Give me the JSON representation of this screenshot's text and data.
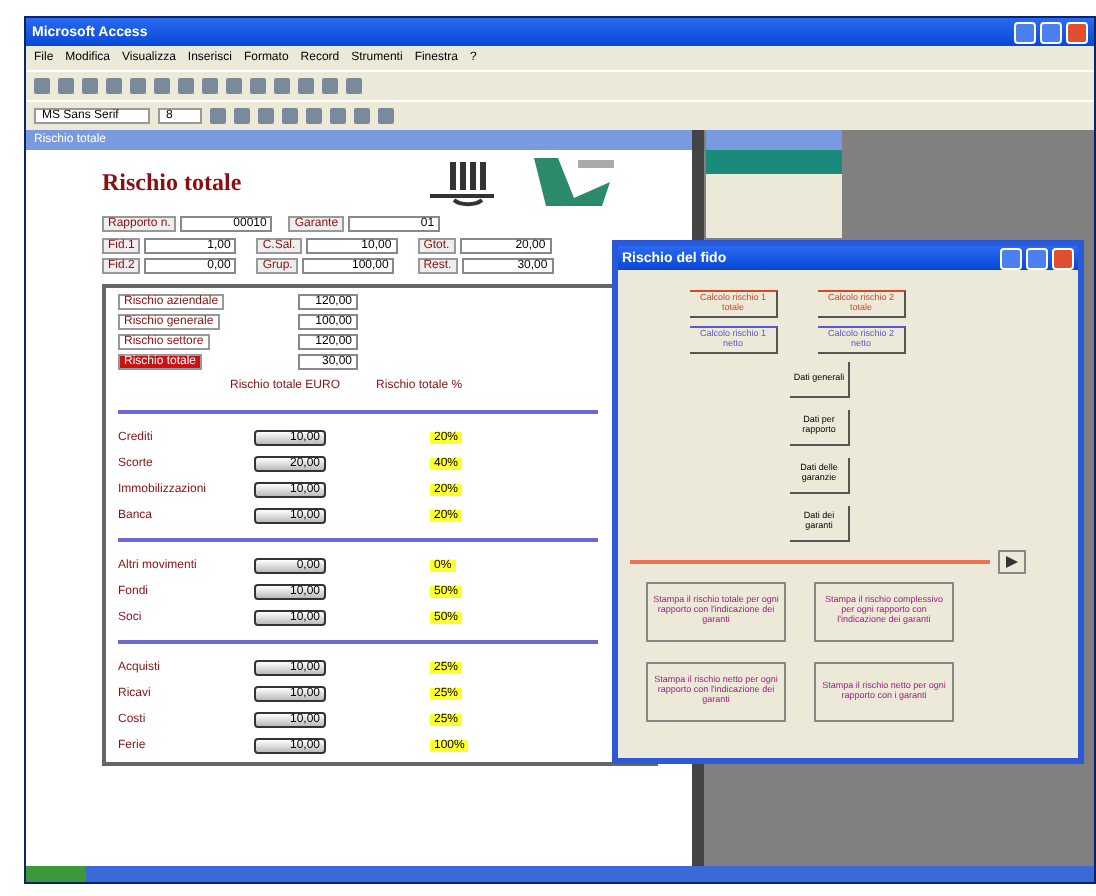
{
  "window": {
    "title": "Microsoft Access"
  },
  "menu": [
    "File",
    "Modifica",
    "Visualizza",
    "Inserisci",
    "Formato",
    "Record",
    "Strumenti",
    "Finestra",
    "?"
  ],
  "format_bar": {
    "font": "MS Sans Serif",
    "size": "8"
  },
  "form": {
    "title": "Rischio totale",
    "window_title": "Rischio totale",
    "top_fields": [
      {
        "label": "Rapporto n.",
        "value": "00010"
      },
      {
        "label": "Garante",
        "value": "01"
      }
    ],
    "grid_fields": [
      {
        "label": "Fid.1",
        "value": "1,00"
      },
      {
        "label": "C.Sal.",
        "value": "10,00"
      },
      {
        "label": "Gtot.",
        "value": "20,00"
      },
      {
        "label": "Fid.2",
        "value": "0,00"
      },
      {
        "label": "Grup.",
        "value": "100,00"
      },
      {
        "label": "Rest.",
        "value": "30,00"
      }
    ],
    "summary": [
      {
        "label": "Rischio aziendale",
        "value": "120,00",
        "highlighted": false
      },
      {
        "label": "Rischio generale",
        "value": "100,00",
        "highlighted": false
      },
      {
        "label": "Rischio settore",
        "value": "120,00",
        "highlighted": false
      },
      {
        "label": "Rischio totale",
        "value": "30,00",
        "highlighted": true
      }
    ],
    "columns": [
      "Rischio totale EURO",
      "Rischio totale %"
    ],
    "groups": [
      [
        {
          "label": "Crediti",
          "value": "10,00",
          "percent": "20%"
        },
        {
          "label": "Scorte",
          "value": "20,00",
          "percent": "40%"
        },
        {
          "label": "Immobilizzazioni",
          "value": "10,00",
          "percent": "20%"
        },
        {
          "label": "Banca",
          "value": "10,00",
          "percent": "20%"
        }
      ],
      [
        {
          "label": "Altri movimenti",
          "value": "0,00",
          "percent": "0%"
        },
        {
          "label": "Fondi",
          "value": "10,00",
          "percent": "50%"
        },
        {
          "label": "Soci",
          "value": "10,00",
          "percent": "50%"
        }
      ],
      [
        {
          "label": "Acquisti",
          "value": "10,00",
          "percent": "25%"
        },
        {
          "label": "Ricavi",
          "value": "10,00",
          "percent": "25%"
        },
        {
          "label": "Costi",
          "value": "10,00",
          "percent": "25%"
        },
        {
          "label": "Ferie",
          "value": "10,00",
          "percent": "100%"
        }
      ]
    ]
  },
  "dialog": {
    "title": "Rischio del fido",
    "calc_buttons": [
      {
        "label": "Calcolo rischio 1 totale",
        "color": "#d04a2a"
      },
      {
        "label": "Calcolo rischio 2 totale",
        "color": "#d04a2a"
      },
      {
        "label": "Calcolo rischio 1 netto",
        "color": "#5a5ad0"
      },
      {
        "label": "Calcolo rischio 2 netto",
        "color": "#5a5ad0"
      }
    ],
    "data_buttons": [
      "Dati generali",
      "Dati per rapporto",
      "Dati delle garanzie",
      "Dati dei garanti"
    ],
    "report_buttons": [
      "Stampa il rischio totale per ogni rapporto con l'indicazione dei garanti",
      "Stampa il rischio complessivo per ogni rapporto con l'indicazione dei garanti",
      "Stampa il rischio netto per ogni rapporto con l'indicazione dei garanti",
      "Stampa il rischio netto per ogni rapporto con i garanti"
    ]
  }
}
